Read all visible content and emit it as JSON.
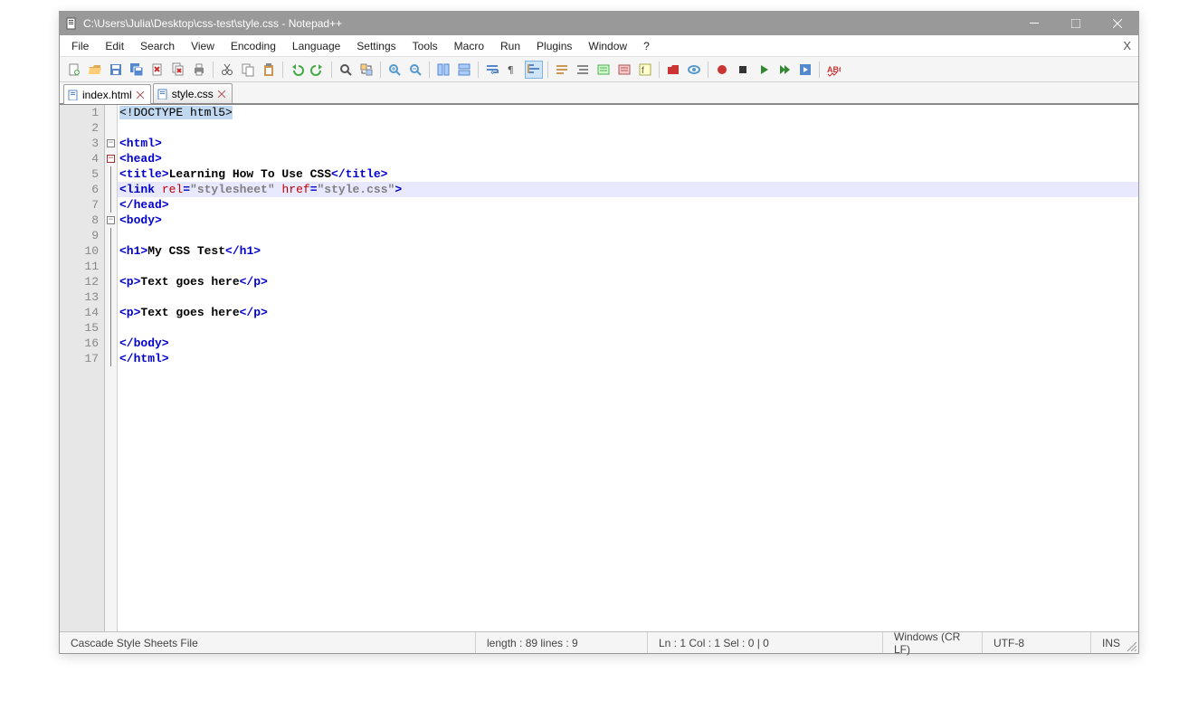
{
  "title": "C:\\Users\\Julia\\Desktop\\css-test\\style.css - Notepad++",
  "menus": [
    "File",
    "Edit",
    "Search",
    "View",
    "Encoding",
    "Language",
    "Settings",
    "Tools",
    "Macro",
    "Run",
    "Plugins",
    "Window",
    "?"
  ],
  "tabs": [
    {
      "label": "index.html",
      "active": true
    },
    {
      "label": "style.css",
      "active": false
    }
  ],
  "lines": [
    {
      "n": 1,
      "fold": "",
      "tokens": [
        {
          "cls": "sel",
          "t": "<!DOCTYPE html5>"
        }
      ]
    },
    {
      "n": 2,
      "fold": "",
      "tokens": []
    },
    {
      "n": 3,
      "fold": "box",
      "tokens": [
        {
          "cls": "tag",
          "t": "<html>"
        }
      ]
    },
    {
      "n": 4,
      "fold": "box-minus",
      "tokens": [
        {
          "cls": "tag",
          "t": "<head>"
        }
      ]
    },
    {
      "n": 5,
      "fold": "line",
      "tokens": [
        {
          "cls": "tag",
          "t": "<title>"
        },
        {
          "cls": "txt",
          "t": "Learning How To Use CSS"
        },
        {
          "cls": "tag",
          "t": "</title>"
        }
      ]
    },
    {
      "n": 6,
      "fold": "line",
      "hl": true,
      "tokens": [
        {
          "cls": "tag",
          "t": "<link "
        },
        {
          "cls": "attr",
          "t": "rel"
        },
        {
          "cls": "tag",
          "t": "="
        },
        {
          "cls": "str",
          "t": "\"stylesheet\""
        },
        {
          "cls": "tag",
          "t": " "
        },
        {
          "cls": "attr",
          "t": "href"
        },
        {
          "cls": "tag",
          "t": "="
        },
        {
          "cls": "str",
          "t": "\"style.css\""
        },
        {
          "cls": "tag",
          "t": ">"
        }
      ]
    },
    {
      "n": 7,
      "fold": "line",
      "tokens": [
        {
          "cls": "tag",
          "t": "</head>"
        }
      ]
    },
    {
      "n": 8,
      "fold": "box",
      "tokens": [
        {
          "cls": "tag",
          "t": "<body>"
        }
      ]
    },
    {
      "n": 9,
      "fold": "line",
      "tokens": []
    },
    {
      "n": 10,
      "fold": "line",
      "tokens": [
        {
          "cls": "tag",
          "t": "<h1>"
        },
        {
          "cls": "txt",
          "t": "My CSS Test"
        },
        {
          "cls": "tag",
          "t": "</h1>"
        }
      ]
    },
    {
      "n": 11,
      "fold": "line",
      "tokens": []
    },
    {
      "n": 12,
      "fold": "line",
      "tokens": [
        {
          "cls": "tag",
          "t": "<p>"
        },
        {
          "cls": "txt",
          "t": "Text goes here"
        },
        {
          "cls": "tag",
          "t": "</p>"
        }
      ]
    },
    {
      "n": 13,
      "fold": "line",
      "tokens": []
    },
    {
      "n": 14,
      "fold": "line",
      "tokens": [
        {
          "cls": "tag",
          "t": "<p>"
        },
        {
          "cls": "txt",
          "t": "Text goes here"
        },
        {
          "cls": "tag",
          "t": "</p>"
        }
      ]
    },
    {
      "n": 15,
      "fold": "line",
      "tokens": []
    },
    {
      "n": 16,
      "fold": "line",
      "tokens": [
        {
          "cls": "tag",
          "t": "</body>"
        }
      ]
    },
    {
      "n": 17,
      "fold": "line",
      "tokens": [
        {
          "cls": "tag",
          "t": "</html>"
        }
      ]
    }
  ],
  "status": {
    "filetype": "Cascade Style Sheets File",
    "length": "length : 89    lines : 9",
    "pos": "Ln : 1    Col : 1    Sel : 0 | 0",
    "eol": "Windows (CR LF)",
    "enc": "UTF-8",
    "ins": "INS"
  },
  "toolbar_icons": [
    "new",
    "open",
    "save",
    "save-all",
    "close",
    "close-all",
    "print",
    "sep",
    "cut",
    "copy",
    "paste",
    "sep",
    "undo",
    "redo",
    "sep",
    "find",
    "replace",
    "sep",
    "zoom-in",
    "zoom-out",
    "sep",
    "sync-v",
    "sync-h",
    "sep",
    "wrap",
    "all-chars",
    "indent",
    "sep",
    "lang",
    "eol",
    "comment",
    "uncomment",
    "func",
    "sep",
    "folder",
    "hide",
    "sep",
    "record",
    "stop",
    "play",
    "play-multi",
    "save-macro",
    "sep",
    "spell"
  ]
}
